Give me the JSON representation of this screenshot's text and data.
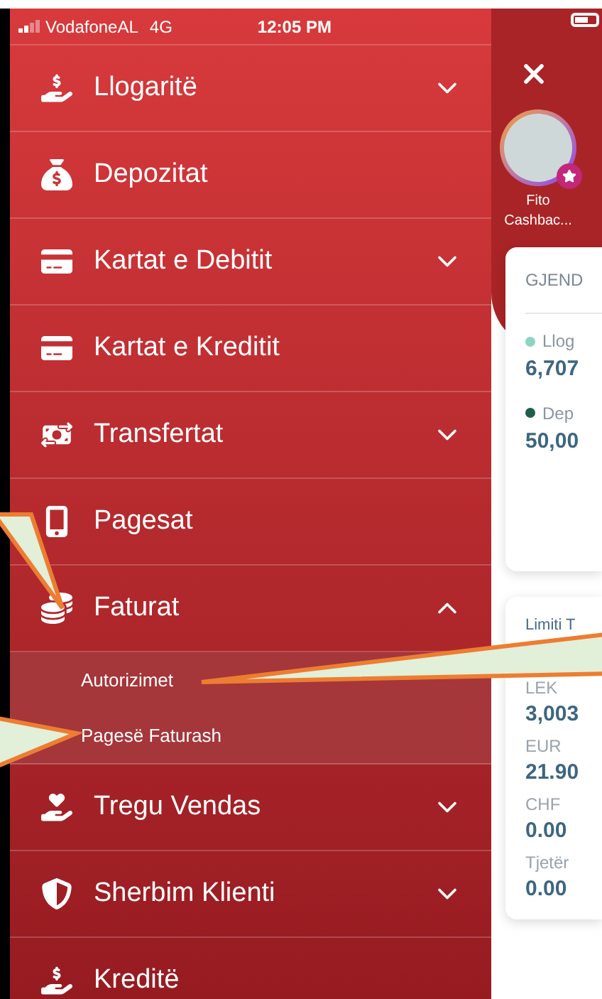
{
  "status_bar": {
    "carrier": "VodafoneAL",
    "network": "4G",
    "time": "12:05 PM"
  },
  "menu": {
    "items": [
      {
        "label": "Llogaritë",
        "expandable": true,
        "expanded": false
      },
      {
        "label": "Depozitat",
        "expandable": false
      },
      {
        "label": "Kartat e Debitit",
        "expandable": true,
        "expanded": false
      },
      {
        "label": "Kartat e Kreditit",
        "expandable": false
      },
      {
        "label": "Transfertat",
        "expandable": true,
        "expanded": false
      },
      {
        "label": "Pagesat",
        "expandable": false
      },
      {
        "label": "Faturat",
        "expandable": true,
        "expanded": true,
        "children": [
          {
            "label": "Autorizimet"
          },
          {
            "label": "Pagesë Faturash"
          }
        ]
      },
      {
        "label": "Tregu Vendas",
        "expandable": true,
        "expanded": false
      },
      {
        "label": "Sherbim Klienti",
        "expandable": true,
        "expanded": false
      },
      {
        "label": "Kreditë",
        "expandable": false
      }
    ]
  },
  "promo": {
    "label": "Fito Cashbac..."
  },
  "balance_card": {
    "title": "GJEND",
    "entries": [
      {
        "label": "Llog",
        "value": "6,707",
        "color": "#8fd3c4"
      },
      {
        "label": "Dep",
        "value": "50,00",
        "color": "#1f5e4a"
      }
    ]
  },
  "limits_card": {
    "title": "Limiti T",
    "entries": [
      {
        "currency": "LEK",
        "amount": "3,003"
      },
      {
        "currency": "EUR",
        "amount": "21.90"
      },
      {
        "currency": "CHF",
        "amount": "0.00"
      },
      {
        "currency": "Tjetër",
        "amount": "0.00"
      }
    ]
  }
}
